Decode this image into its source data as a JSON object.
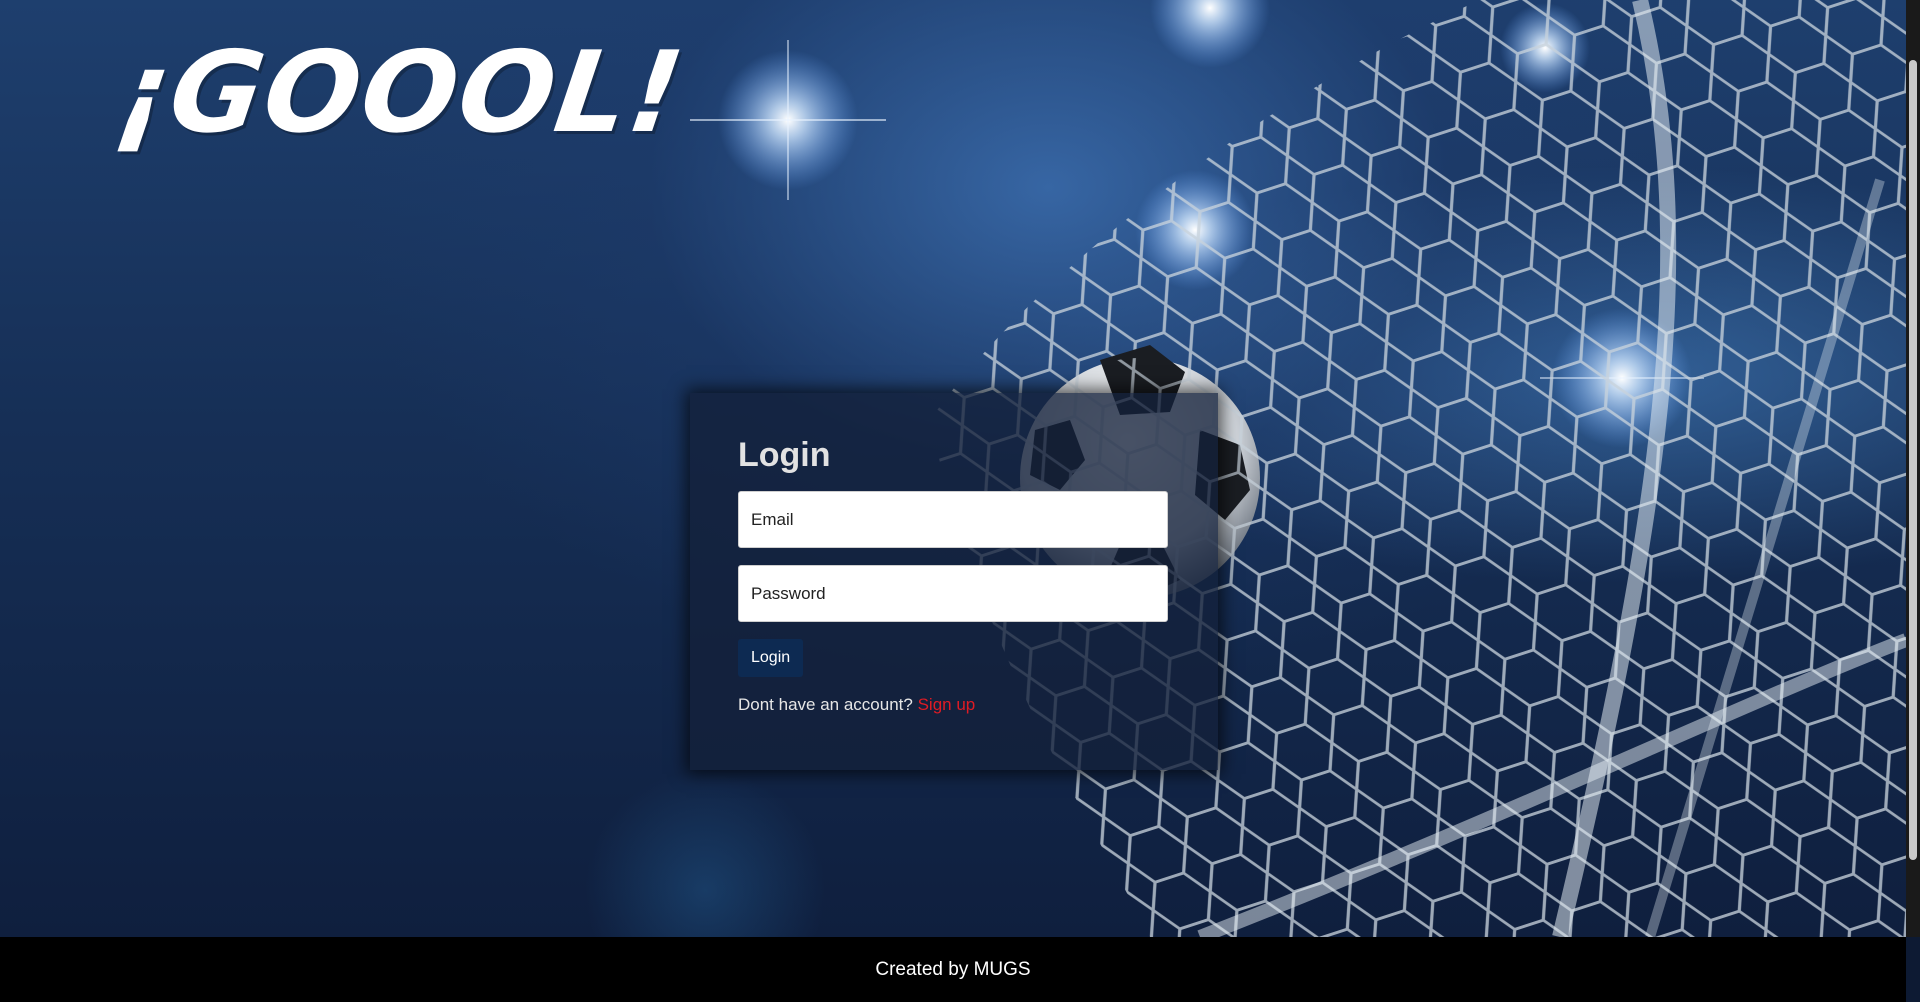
{
  "brand": {
    "logo_text": "¡GOOOL!"
  },
  "login": {
    "title": "Login",
    "email_placeholder": "Email",
    "password_placeholder": "Password",
    "button_label": "Login",
    "signup_prompt": "Dont have an account?",
    "signup_link": "Sign up"
  },
  "footer": {
    "text": "Created by MUGS"
  },
  "colors": {
    "button_bg": "#0d2a52",
    "signup_link": "#e01b24",
    "footer_bg": "#000000",
    "background": "#162f56"
  },
  "icons": [
    "stadium-light-icon",
    "soccer-ball-icon",
    "goal-net-icon"
  ]
}
